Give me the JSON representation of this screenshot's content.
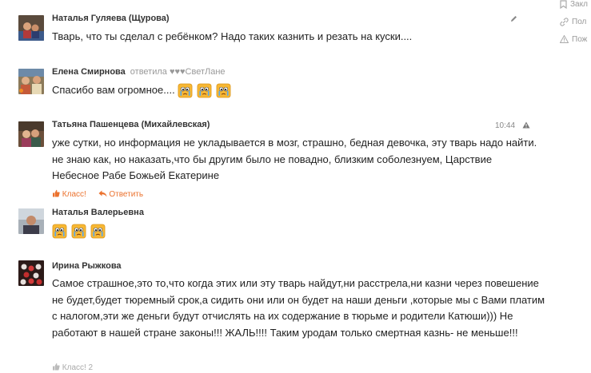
{
  "comments": [
    {
      "author": "Наталья Гуляева (Щурова)",
      "text": "Тварь, что ты сделал с ребёнком? Надо таких казнить и резать на куски....",
      "avatar_icon": "user-photo-icon",
      "header_icon": "pencil-icon"
    },
    {
      "author": "Елена Смирнова",
      "reply": "ответила ♥♥♥СветЛане",
      "text": "Спасибо вам огромное....",
      "emoji_icon": "crying-smiley-icon",
      "emoji_count": 3,
      "online": true
    },
    {
      "author": "Татьяна Пашенцева (Михайлевская)",
      "time": "10:44",
      "header_icon": "warning-icon",
      "text": "уже сутки, но информация не укладывается в мозг, страшно, бедная девочка, эту тварь надо найти. не знаю как, но наказать,что бы другим было не повадно, близким соболезнуем, Царствие Небесное Рабе Божьей Екатерине",
      "like_label": "Класс!",
      "reply_label": "Ответить"
    },
    {
      "author": "Наталья Валерьевна",
      "emoji_icon": "crying-smiley-icon",
      "emoji_count": 3
    },
    {
      "author": "Ирина Рыжкова",
      "text": "Самое страшное,это то,что когда этих или эту тварь найдут,ни расстрела,ни казни через повешение не будет,будет тюремный срок,а сидить они или он будет на наши деньги ,которые мы с Вами платим с налогом,эти же деньги будут отчислять на их содержание в тюрьме и родители Катюши))) Не работают в нашей стране законы!!! ЖАЛЬ!!!! Таким уродам только смертная казнь- не меньше!!!",
      "like_label": "Класс! 2"
    }
  ],
  "right_panel": [
    {
      "label": "Закл",
      "icon": "bookmark-icon"
    },
    {
      "label": "Пол",
      "icon": "link-icon"
    },
    {
      "label": "Пож",
      "icon": "warning-icon"
    }
  ],
  "colors": {
    "accent": "#eb722e",
    "author": "#333333",
    "muted": "#999999",
    "emoji": "#f7b733"
  }
}
